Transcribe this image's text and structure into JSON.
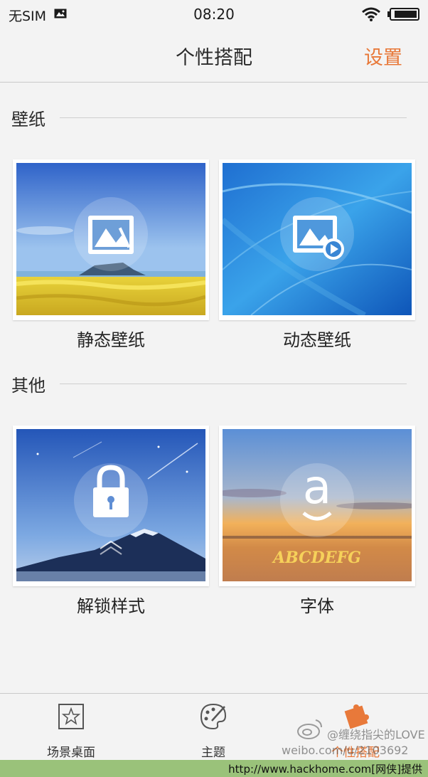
{
  "status_bar": {
    "carrier": "无SIM",
    "time": "08:20"
  },
  "nav": {
    "title": "个性搭配",
    "settings": "设置"
  },
  "sections": [
    {
      "label": "壁纸"
    },
    {
      "label": "其他"
    }
  ],
  "tiles": [
    {
      "label": "静态壁纸",
      "icon": "picture-icon"
    },
    {
      "label": "动态壁纸",
      "icon": "video-picture-icon"
    },
    {
      "label": "解锁样式",
      "icon": "lock-icon"
    },
    {
      "label": "字体",
      "icon": "font-a-icon",
      "sample": "ABCDEFG"
    }
  ],
  "tabs": [
    {
      "label": "场景桌面",
      "icon": "star-frame-icon"
    },
    {
      "label": "主题",
      "icon": "palette-icon"
    },
    {
      "label": "个性搭配",
      "icon": "puzzle-icon",
      "active": true
    }
  ],
  "watermark": {
    "line1": "@缠绕指尖的LOVE",
    "line2": "weibo.com/u/2103692"
  },
  "footer": {
    "text": "http://www.hackhome.com[网侠]提供"
  },
  "colors": {
    "accent": "#e8793a",
    "background": "#f3f3f3"
  }
}
